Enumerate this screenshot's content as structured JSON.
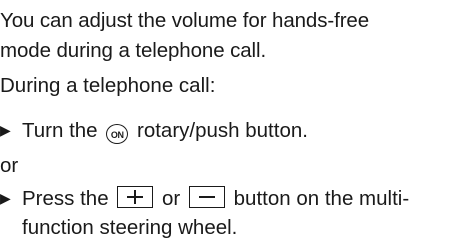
{
  "intro": {
    "line1": "You can adjust the volume for hands-free",
    "line2": "mode during a telephone call."
  },
  "during": "During a telephone call:",
  "step1": {
    "bullet": "▶",
    "before": "Turn the",
    "icon_label": "ON",
    "icon": "on-rotary-push-icon",
    "after": "rotary/push button."
  },
  "or": "or",
  "step2": {
    "bullet": "▶",
    "before": "Press the",
    "plus_icon": "plus-key-icon",
    "middle": "or",
    "minus_icon": "minus-key-icon",
    "after": "button on the multi-",
    "continuation": "function steering wheel."
  }
}
